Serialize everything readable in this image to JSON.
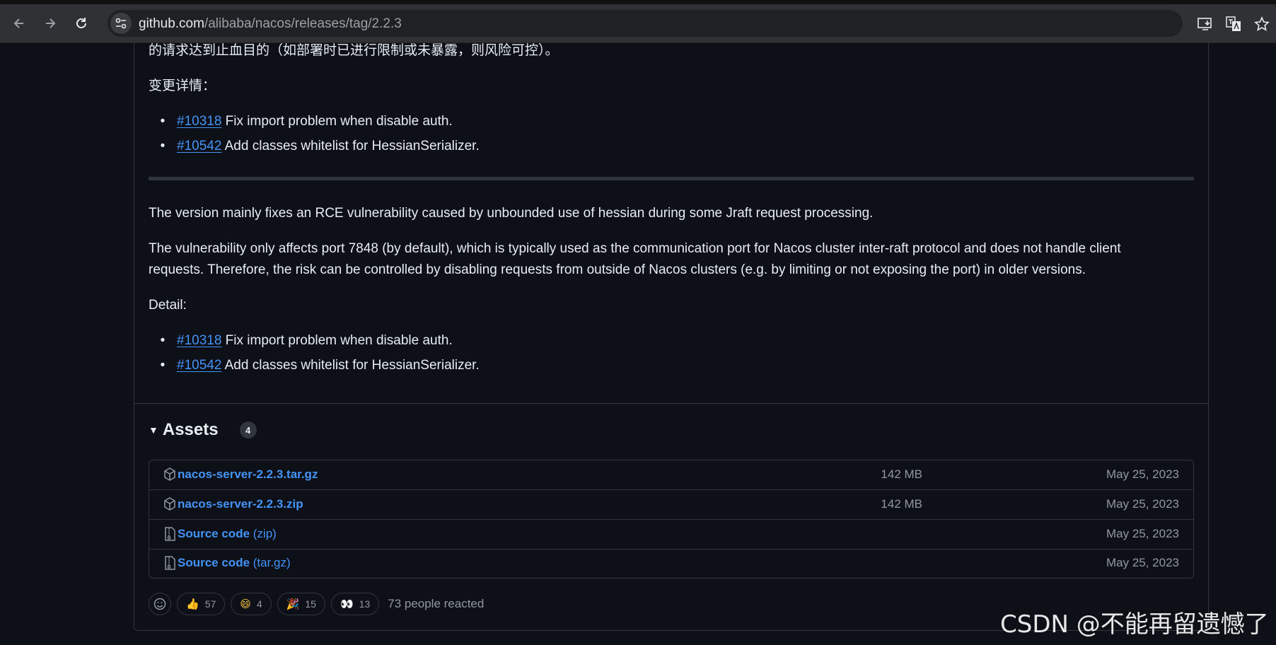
{
  "browser": {
    "url_host": "github.com",
    "url_path": "/alibaba/nacos/releases/tag/2.2.3"
  },
  "release": {
    "cn_cut_line": "的请求达到止血目的（如部署时已进行限制或未暴露，则风险可控）。",
    "cn_detail_label": "变更详情：",
    "cn_items": [
      {
        "link": "#10318",
        "text": " Fix import problem when disable auth."
      },
      {
        "link": "#10542",
        "text": " Add classes whitelist for HessianSerializer."
      }
    ],
    "en_p1": "The version mainly fixes an RCE vulnerability caused by unbounded use of hessian during some Jraft request processing.",
    "en_p2_line1": "The vulnerability only affects port 7848 (by default), which is typically used as the communication port for Nacos cluster inter-raft protocol and does not handle client",
    "en_p2_line2": "requests. Therefore, the risk can be controlled by disabling requests from outside of Nacos clusters (e.g. by limiting or not exposing the port) in older versions.",
    "en_detail_label": "Detail:",
    "en_items": [
      {
        "link": "#10318",
        "text": " Fix import problem when disable auth."
      },
      {
        "link": "#10542",
        "text": " Add classes whitelist for HessianSerializer."
      }
    ]
  },
  "assets": {
    "title": "Assets",
    "count": "4",
    "rows": [
      {
        "icon": "package-icon",
        "name": "nacos-server-2.2.3.tar.gz",
        "sub": "",
        "size": "142 MB",
        "date": "May 25, 2023"
      },
      {
        "icon": "package-icon",
        "name": "nacos-server-2.2.3.zip",
        "sub": "",
        "size": "142 MB",
        "date": "May 25, 2023"
      },
      {
        "icon": "file-zip-icon",
        "name": "Source code",
        "sub": " (zip)",
        "size": "",
        "date": "May 25, 2023"
      },
      {
        "icon": "file-zip-icon",
        "name": "Source code",
        "sub": " (tar.gz)",
        "size": "",
        "date": "May 25, 2023"
      }
    ]
  },
  "reactions": {
    "items": [
      {
        "emoji": "👍",
        "count": "57"
      },
      {
        "emoji": "😄",
        "count": "4"
      },
      {
        "emoji": "🎉",
        "count": "15"
      },
      {
        "emoji": "👀",
        "count": "13"
      }
    ],
    "summary": "73 people reacted"
  },
  "watermark": "CSDN @不能再留遗憾了",
  "colors": {
    "background": "#0d1117",
    "link": "#4493f8",
    "muted": "#9198a1",
    "border": "#30363d"
  }
}
